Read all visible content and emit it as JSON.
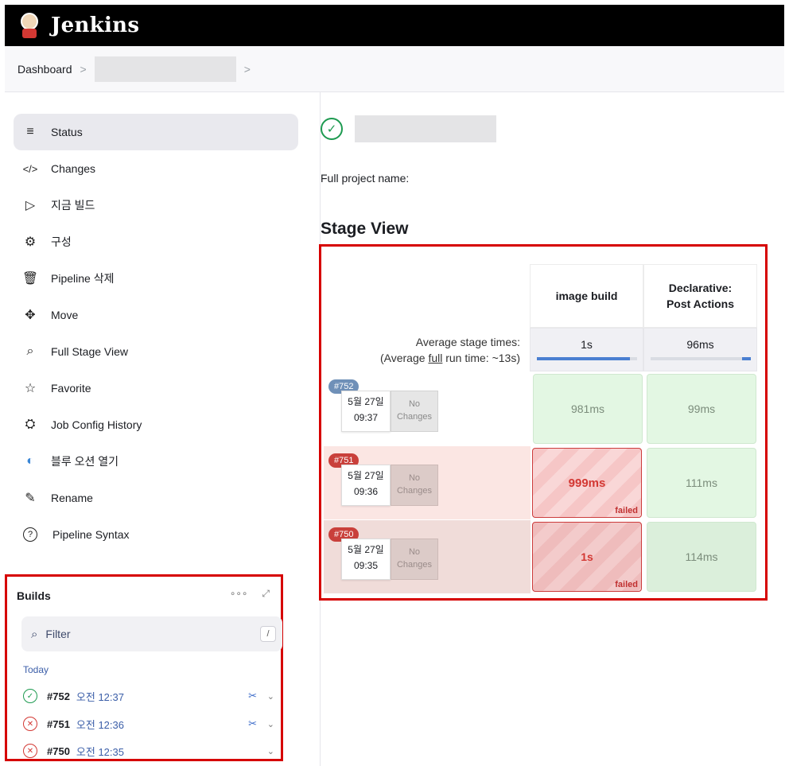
{
  "header": {
    "brand": "Jenkins"
  },
  "breadcrumb": {
    "root": "Dashboard",
    "sep1": ">",
    "sep2": ">"
  },
  "sidebar": {
    "items": [
      {
        "label": "Status",
        "icon": "≡"
      },
      {
        "label": "Changes",
        "icon": "</>"
      },
      {
        "label": "지금 빌드",
        "icon": "▷"
      },
      {
        "label": "구성",
        "icon": "⚙"
      },
      {
        "label": "Pipeline 삭제",
        "icon": "🗑"
      },
      {
        "label": "Move",
        "icon": "✥"
      },
      {
        "label": "Full Stage View",
        "icon": "⌕"
      },
      {
        "label": "Favorite",
        "icon": "☆"
      },
      {
        "label": "Job Config History",
        "icon": "⛭"
      },
      {
        "label": "블루 오션 열기",
        "icon": "◐"
      },
      {
        "label": "Rename",
        "icon": "✎"
      },
      {
        "label": "Pipeline Syntax",
        "icon": "?"
      }
    ]
  },
  "builds": {
    "title": "Builds",
    "more": "∘∘∘",
    "expand": "⤢",
    "filter_placeholder": "Filter",
    "filter_key": "/",
    "group": "Today",
    "rows": [
      {
        "number": "#752",
        "time": "오전 12:37",
        "status": "success"
      },
      {
        "number": "#751",
        "time": "오전 12:36",
        "status": "failed"
      },
      {
        "number": "#750",
        "time": "오전 12:35",
        "status": "failed"
      }
    ]
  },
  "main": {
    "full_project_name_label": "Full project name:",
    "stage_view_title": "Stage View"
  },
  "stage_view": {
    "columns": [
      "image build",
      "Declarative:\nPost Actions"
    ],
    "avg_label_line1": "Average stage times:",
    "avg_label_line2_pre": "(Average ",
    "avg_label_line2_link": "full",
    "avg_label_line2_post": " run time: ~13s)",
    "averages": [
      {
        "value": "1s",
        "bar_fraction": 0.93
      },
      {
        "value": "96ms",
        "bar_fraction": 0.09
      }
    ],
    "runs": [
      {
        "badge": "#752",
        "date": "5월 27일",
        "time": "09:37",
        "changes": "No\nChanges",
        "cells": [
          {
            "value": "981ms",
            "state": "success"
          },
          {
            "value": "99ms",
            "state": "success"
          }
        ]
      },
      {
        "badge": "#751",
        "date": "5월 27일",
        "time": "09:36",
        "changes": "No\nChanges",
        "cells": [
          {
            "value": "999ms",
            "state": "failed",
            "tag": "failed"
          },
          {
            "value": "111ms",
            "state": "success"
          }
        ]
      },
      {
        "badge": "#750",
        "date": "5월 27일",
        "time": "09:35",
        "changes": "No\nChanges",
        "cells": [
          {
            "value": "1s",
            "state": "failed",
            "tag": "failed"
          },
          {
            "value": "114ms",
            "state": "success"
          }
        ]
      }
    ]
  },
  "colors": {
    "success": "#1d9a50",
    "failed": "#d33833",
    "accent": "#3b5ea8",
    "highlight_border": "#d60000"
  }
}
